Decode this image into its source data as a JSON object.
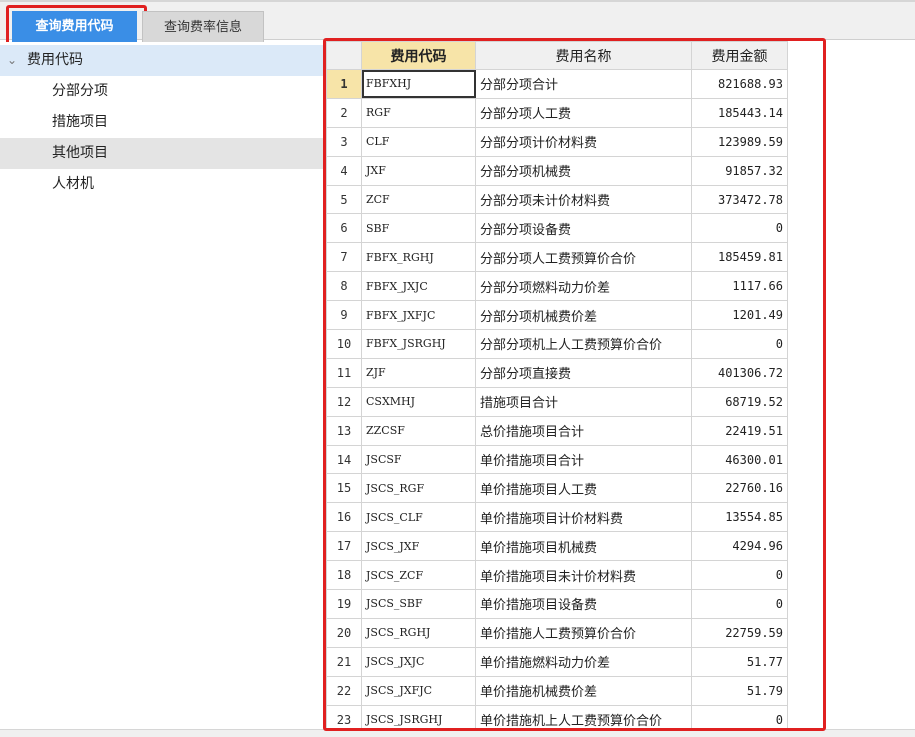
{
  "tabs": [
    {
      "label": "查询费用代码",
      "active": true
    },
    {
      "label": "查询费率信息",
      "active": false
    }
  ],
  "tree": {
    "root": {
      "label": "费用代码",
      "expanded": true
    },
    "children": [
      {
        "label": "分部分项"
      },
      {
        "label": "措施项目"
      },
      {
        "label": "其他项目",
        "selected": true
      },
      {
        "label": "人材机"
      }
    ]
  },
  "grid": {
    "columns": [
      "费用代码",
      "费用名称",
      "费用金额"
    ],
    "rows": [
      {
        "no": "1",
        "code": "FBFXHJ",
        "name": "分部分项合计",
        "amount": "821688.93"
      },
      {
        "no": "2",
        "code": "RGF",
        "name": "分部分项人工费",
        "amount": "185443.14"
      },
      {
        "no": "3",
        "code": "CLF",
        "name": "分部分项计价材料费",
        "amount": "123989.59"
      },
      {
        "no": "4",
        "code": "JXF",
        "name": "分部分项机械费",
        "amount": "91857.32"
      },
      {
        "no": "5",
        "code": "ZCF",
        "name": "分部分项未计价材料费",
        "amount": "373472.78"
      },
      {
        "no": "6",
        "code": "SBF",
        "name": "分部分项设备费",
        "amount": "0"
      },
      {
        "no": "7",
        "code": "FBFX_RGHJ",
        "name": "分部分项人工费预算价合价",
        "amount": "185459.81"
      },
      {
        "no": "8",
        "code": "FBFX_JXJC",
        "name": "分部分项燃料动力价差",
        "amount": "1117.66"
      },
      {
        "no": "9",
        "code": "FBFX_JXFJC",
        "name": "分部分项机械费价差",
        "amount": "1201.49"
      },
      {
        "no": "10",
        "code": "FBFX_JSRGHJ",
        "name": "分部分项机上人工费预算价合价",
        "amount": "0"
      },
      {
        "no": "11",
        "code": "ZJF",
        "name": "分部分项直接费",
        "amount": "401306.72"
      },
      {
        "no": "12",
        "code": "CSXMHJ",
        "name": "措施项目合计",
        "amount": "68719.52"
      },
      {
        "no": "13",
        "code": "ZZCSF",
        "name": "总价措施项目合计",
        "amount": "22419.51"
      },
      {
        "no": "14",
        "code": "JSCSF",
        "name": "单价措施项目合计",
        "amount": "46300.01"
      },
      {
        "no": "15",
        "code": "JSCS_RGF",
        "name": "单价措施项目人工费",
        "amount": "22760.16"
      },
      {
        "no": "16",
        "code": "JSCS_CLF",
        "name": "单价措施项目计价材料费",
        "amount": "13554.85"
      },
      {
        "no": "17",
        "code": "JSCS_JXF",
        "name": "单价措施项目机械费",
        "amount": "4294.96"
      },
      {
        "no": "18",
        "code": "JSCS_ZCF",
        "name": "单价措施项目未计价材料费",
        "amount": "0"
      },
      {
        "no": "19",
        "code": "JSCS_SBF",
        "name": "单价措施项目设备费",
        "amount": "0"
      },
      {
        "no": "20",
        "code": "JSCS_RGHJ",
        "name": "单价措施人工费预算价合价",
        "amount": "22759.59"
      },
      {
        "no": "21",
        "code": "JSCS_JXJC",
        "name": "单价措施燃料动力价差",
        "amount": "51.77"
      },
      {
        "no": "22",
        "code": "JSCS_JXFJC",
        "name": "单价措施机械费价差",
        "amount": "51.79"
      },
      {
        "no": "23",
        "code": "JSCS_JSRGHJ",
        "name": "单价措施机上人工费预算价合价",
        "amount": "0"
      }
    ]
  },
  "colors": {
    "tab_active_bg": "#3a8ee6",
    "highlight_frame": "#e02020",
    "header_active_bg": "#f7e4a8",
    "tree_root_bg": "#dbe9f8",
    "tree_selected_bg": "#e4e4e4"
  },
  "icons": {
    "tree_expand": "chevron-down-icon"
  }
}
